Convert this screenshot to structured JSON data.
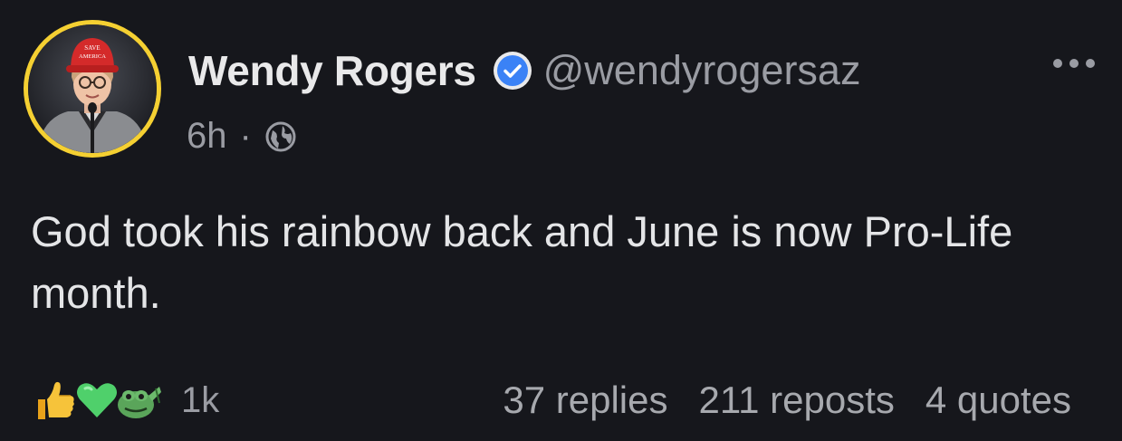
{
  "author": {
    "display_name": "Wendy Rogers",
    "handle": "@wendyrogersaz",
    "avatar_hat_text_top": "SAVE",
    "avatar_hat_text_bottom": "AMERICA"
  },
  "meta": {
    "timestamp": "6h",
    "separator": "·",
    "visibility_icon": "globe-icon"
  },
  "post": {
    "text": "God took his rainbow back and June is now Pro-Life month."
  },
  "reactions": {
    "icons": [
      "thumbs-up-icon",
      "green-heart-icon",
      "frog-salute-icon"
    ],
    "count": "1k"
  },
  "stats": {
    "replies": "37 replies",
    "reposts": "211 reposts",
    "quotes": "4 quotes"
  },
  "colors": {
    "background": "#16171c",
    "verified_badge": "#3b82f6",
    "avatar_ring": "#f5d032",
    "secondary_text": "#9a9ca3"
  }
}
